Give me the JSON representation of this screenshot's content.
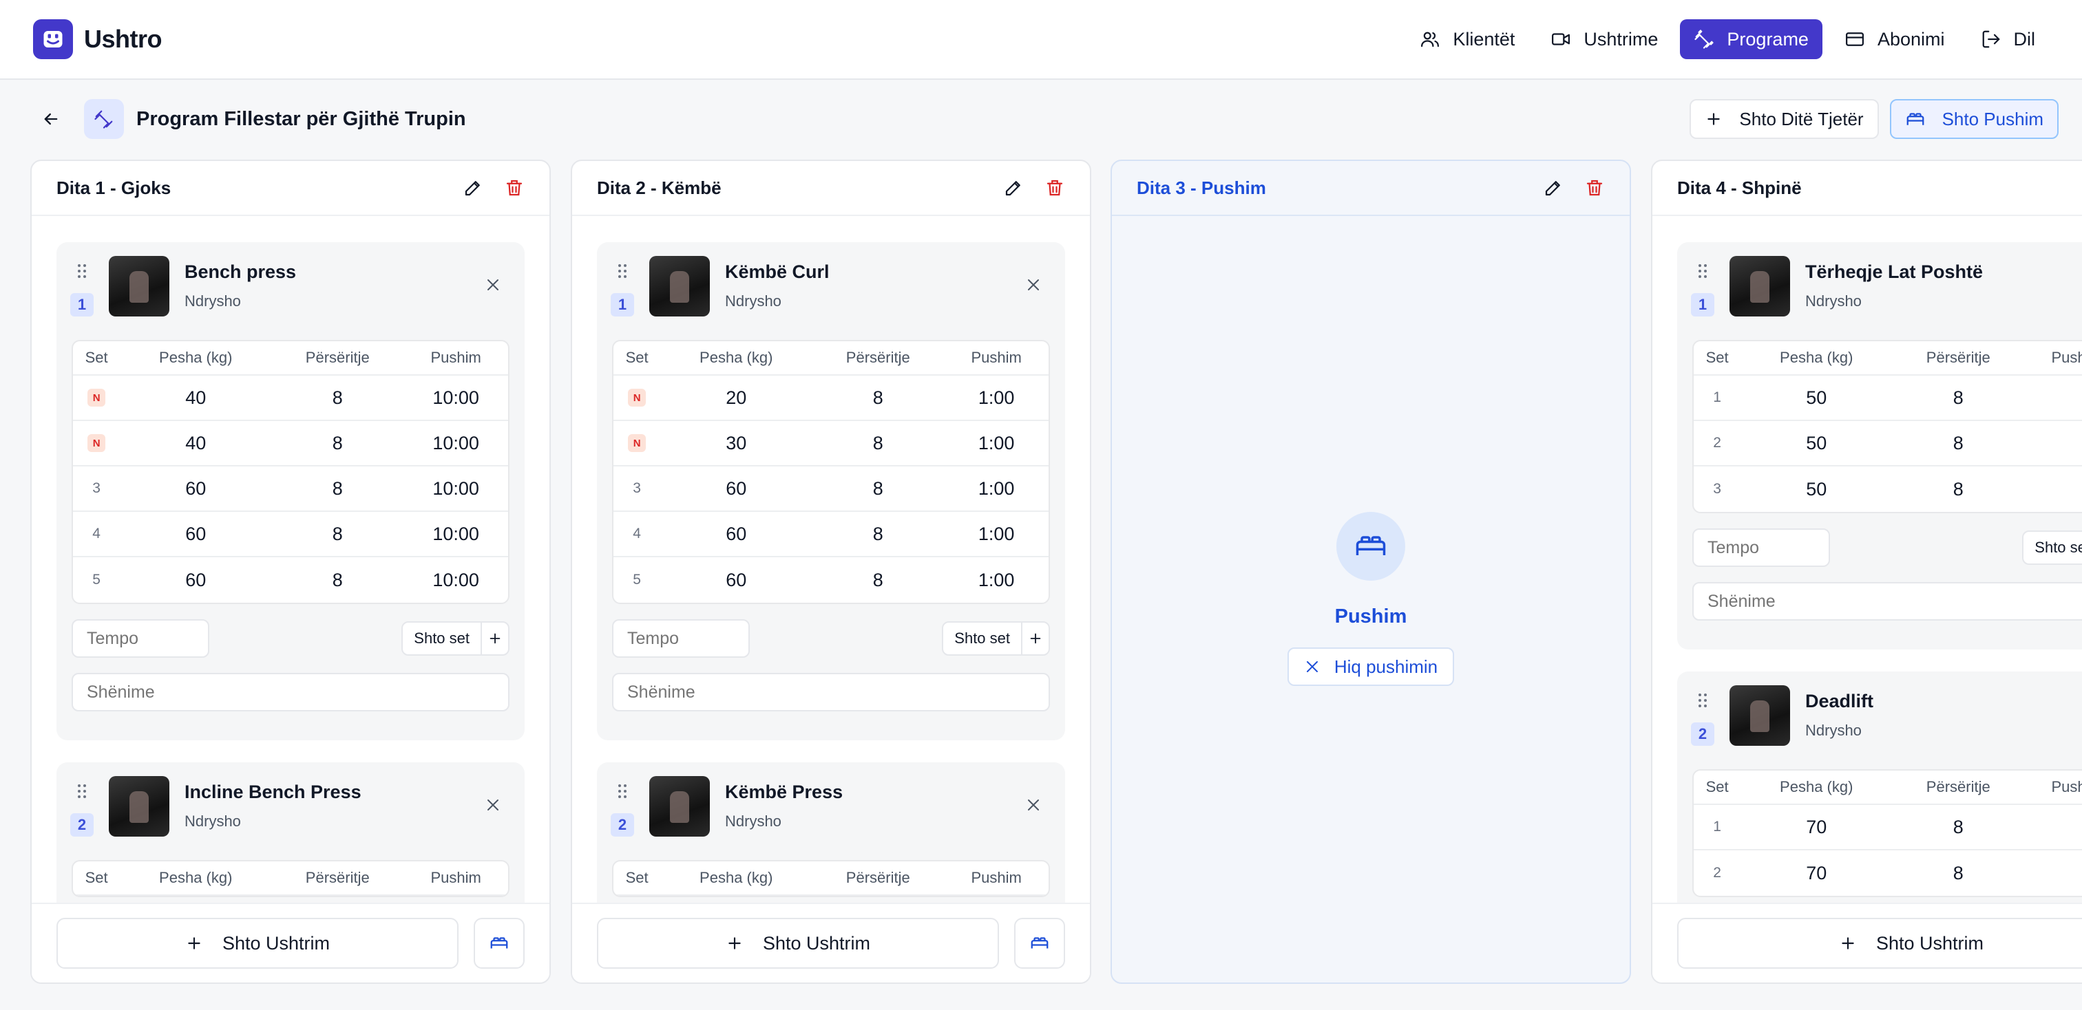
{
  "brand": {
    "name": "Ushtro"
  },
  "nav": [
    {
      "label": "Klientët",
      "icon": "users-icon",
      "active": false
    },
    {
      "label": "Ushtrime",
      "icon": "video-icon",
      "active": false
    },
    {
      "label": "Programe",
      "icon": "dumbbell-icon",
      "active": true
    },
    {
      "label": "Abonimi",
      "icon": "credit-card-icon",
      "active": false
    },
    {
      "label": "Dil",
      "icon": "logout-icon",
      "active": false
    }
  ],
  "program": {
    "title": "Program Fillestar për Gjithë Trupin",
    "add_day_label": "Shto Ditë Tjetër",
    "add_rest_label": "Shto Pushim"
  },
  "table_headers": {
    "set": "Set",
    "weight": "Pesha (kg)",
    "reps": "Përsëritje",
    "rest": "Pushim"
  },
  "common": {
    "edit_label": "Ndrysho",
    "tempo_placeholder": "Tempo",
    "notes_placeholder": "Shënime",
    "add_set_label": "Shto set",
    "add_exercise_label": "Shto Ushtrim",
    "warmup_badge": "N"
  },
  "days": [
    {
      "title": "Dita 1 - Gjoks",
      "exercises": [
        {
          "index": "1",
          "name": "Bench press",
          "sets": [
            {
              "set": "N",
              "weight": "40",
              "reps": "8",
              "rest": "10:00"
            },
            {
              "set": "N",
              "weight": "40",
              "reps": "8",
              "rest": "10:00"
            },
            {
              "set": "3",
              "weight": "60",
              "reps": "8",
              "rest": "10:00"
            },
            {
              "set": "4",
              "weight": "60",
              "reps": "8",
              "rest": "10:00"
            },
            {
              "set": "5",
              "weight": "60",
              "reps": "8",
              "rest": "10:00"
            }
          ]
        },
        {
          "index": "2",
          "name": "Incline Bench Press",
          "sets": []
        }
      ]
    },
    {
      "title": "Dita 2 - Këmbë",
      "exercises": [
        {
          "index": "1",
          "name": "Këmbë Curl",
          "sets": [
            {
              "set": "N",
              "weight": "20",
              "reps": "8",
              "rest": "1:00"
            },
            {
              "set": "N",
              "weight": "30",
              "reps": "8",
              "rest": "1:00"
            },
            {
              "set": "3",
              "weight": "60",
              "reps": "8",
              "rest": "1:00"
            },
            {
              "set": "4",
              "weight": "60",
              "reps": "8",
              "rest": "1:00"
            },
            {
              "set": "5",
              "weight": "60",
              "reps": "8",
              "rest": "1:00"
            }
          ]
        },
        {
          "index": "2",
          "name": "Këmbë Press",
          "sets": []
        }
      ]
    },
    {
      "title": "Dita 3 - Pushim",
      "rest_label": "Pushim",
      "remove_rest_label": "Hiq pushimin"
    },
    {
      "title": "Dita 4 - Shpinë",
      "exercises": [
        {
          "index": "1",
          "name": "Tërheqje Lat Poshtë",
          "sets": [
            {
              "set": "1",
              "weight": "50",
              "reps": "8",
              "rest": ""
            },
            {
              "set": "2",
              "weight": "50",
              "reps": "8",
              "rest": ""
            },
            {
              "set": "3",
              "weight": "50",
              "reps": "8",
              "rest": ""
            }
          ]
        },
        {
          "index": "2",
          "name": "Deadlift",
          "sets": [
            {
              "set": "1",
              "weight": "70",
              "reps": "8",
              "rest": ""
            },
            {
              "set": "2",
              "weight": "70",
              "reps": "8",
              "rest": ""
            }
          ]
        }
      ]
    }
  ],
  "colors": {
    "accent": "#4338ca",
    "rest_blue": "#1d4ed8",
    "danger": "#dc2626"
  }
}
